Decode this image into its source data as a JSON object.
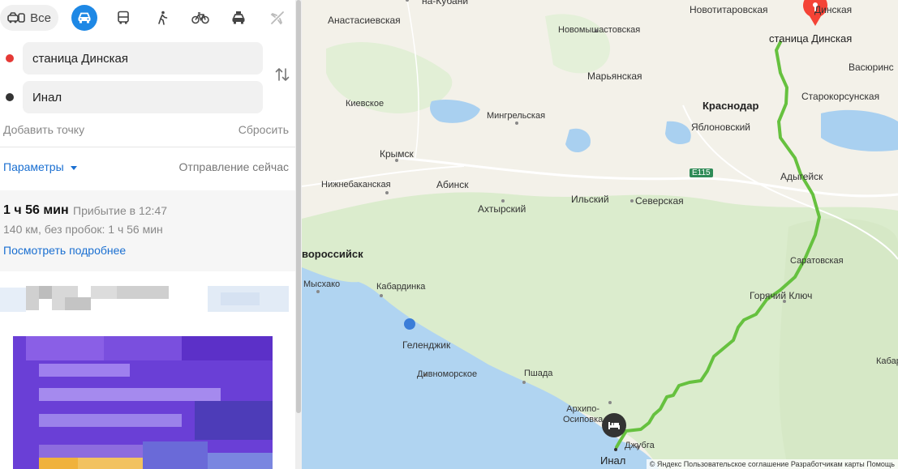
{
  "modes": {
    "all_label": "Все",
    "items": [
      "car-icon",
      "bus-icon",
      "walk-icon",
      "bike-icon",
      "taxi-icon",
      "plane-icon"
    ]
  },
  "route": {
    "from": "станица Динская",
    "to": "Инал",
    "add_point": "Добавить точку",
    "reset": "Сбросить",
    "params": "Параметры",
    "departure": "Отправление сейчас",
    "duration": "1 ч 56 мин",
    "arrival": "Прибытие в 12:47",
    "distance": "140 км, без пробок: 1 ч 56 мин",
    "details": "Посмотреть подробнее"
  },
  "colors": {
    "accent": "#1e88e5",
    "route_line": "#66c13f",
    "sea": "#b0d4f1",
    "land": "#f3f1e9",
    "forest": "#dbeccd",
    "start_dot": "#e53935",
    "end_dot": "#333333"
  },
  "map": {
    "places": {
      "kuban": "на-Кубани",
      "anastasievskaya": "Анастасиевская",
      "novotitarovskaya": "Новотитаровская",
      "dinskaya": "станица Динская",
      "dinskaya_top": "Динская",
      "novomyshastovskaya": "Новомышастовская",
      "maryanskaya": "Марьянская",
      "vasyurinskaya": "Васюринс",
      "krasnodar": "Краснодар",
      "starokorsunskaya": "Старокорсунская",
      "kievskoe": "Киевское",
      "mingrelskaya": "Мингрельская",
      "yablonovsky": "Яблоновский",
      "krymsk": "Крымск",
      "adygeysk": "Адыгейск",
      "e115": "E115",
      "nizhnebakanskaya": "Нижнебаканская",
      "abinsk": "Абинск",
      "ilsky": "Ильский",
      "severskaya": "Северская",
      "akhtyrsky": "Ахтырский",
      "novorossiysk": "вороссийск",
      "saratovskaya": "Саратовская",
      "myskhako": "Мысхако",
      "kabardinka": "Кабардинка",
      "goryachy_klyuch": "Горячий Ключ",
      "gelendzhik": "Геленджик",
      "divnomorskoe": "Дивноморское",
      "pshada": "Пшада",
      "kabar": "Кабар",
      "arkhipo_osipovka": "Архипо-\nОсиповка",
      "dzhubga": "Джубга",
      "inal": "Инал"
    },
    "copyright": "© Яндекс  Пользовательское соглашение  Разработчикам карты  Помощь"
  }
}
